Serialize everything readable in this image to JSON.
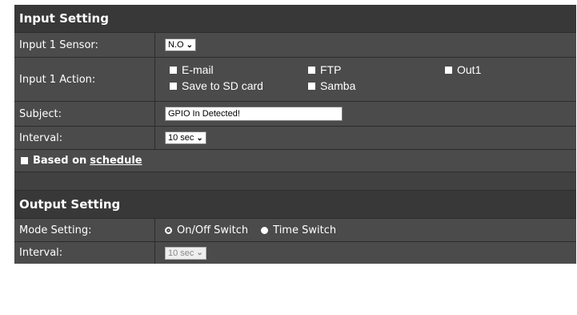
{
  "input_section": {
    "title": "Input Setting",
    "sensor": {
      "label": "Input 1 Sensor:",
      "value": "N.O"
    },
    "action": {
      "label": "Input 1 Action:",
      "options": [
        "E-mail",
        "FTP",
        "Out1",
        "Save to SD card",
        "Samba"
      ]
    },
    "subject": {
      "label": "Subject:",
      "value": "GPIO In Detected!"
    },
    "interval": {
      "label": "Interval:",
      "value": "10 sec"
    },
    "schedule": {
      "prefix": "Based on",
      "link": "schedule"
    }
  },
  "output_section": {
    "title": "Output Setting",
    "mode": {
      "label": "Mode Setting:",
      "options": [
        "On/Off Switch",
        "Time Switch"
      ],
      "selected": "On/Off Switch"
    },
    "interval": {
      "label": "Interval:",
      "value": "10 sec"
    }
  },
  "colors": {
    "header_bg": "#383838",
    "row_bg": "#4b4b4b",
    "text": "#ffffff"
  },
  "icons": {
    "dropdown": "chevron-down-icon",
    "checkbox": "checkbox-icon",
    "radio": "radio-icon"
  }
}
